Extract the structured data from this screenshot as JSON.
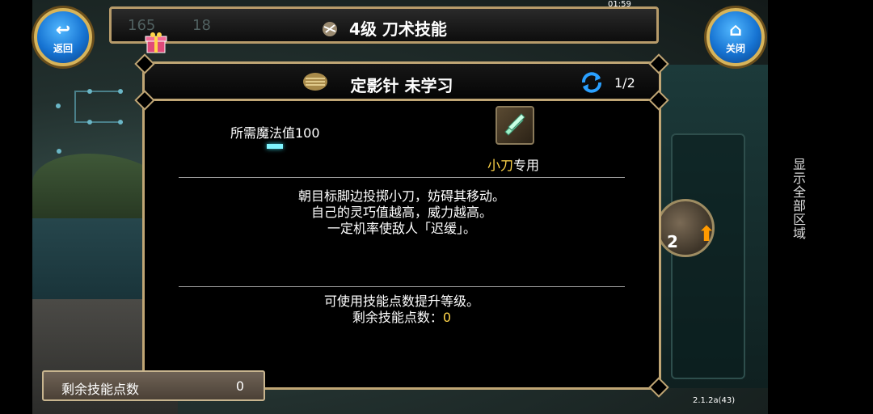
{
  "header": {
    "title": "4级  刀术技能",
    "back_label": "返回",
    "close_label": "关闭",
    "bg_stats": [
      "165",
      "18"
    ]
  },
  "skill": {
    "name_status": "定影针  未学习",
    "page": "1/2",
    "mana_label": "所需魔法值100",
    "weapon_highlight": "小刀",
    "weapon_suffix": "专用",
    "description": [
      "朝目标脚边投掷小刀，妨碍其移动。",
      "自己的灵巧值越高，威力越高。",
      "一定机率使敌人「迟缓」。"
    ],
    "upgrade_hint": "可使用技能点数提升等级。",
    "remaining_label": "剩余技能点数：",
    "remaining_value": "0"
  },
  "footer_panel": {
    "label": "剩余技能点数",
    "value": "0"
  },
  "side_orb": {
    "level": "2"
  },
  "version": "2.1.2a(43)",
  "status_time": "01:59",
  "side_button": "显示全部区域",
  "colors": {
    "frame_gold": "#c0a675",
    "highlight_yellow": "#ffd54a",
    "mana_cyan": "#7ff5ff",
    "button_blue": "#1673d2"
  },
  "icons": [
    "back-arrow-icon",
    "home-icon",
    "gift-icon",
    "scroll-icon",
    "refresh-icon",
    "dagger-icon"
  ]
}
